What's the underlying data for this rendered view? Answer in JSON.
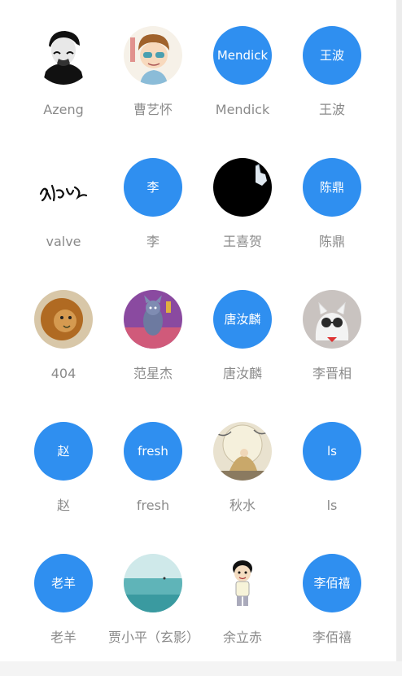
{
  "contacts": [
    {
      "name": "Azeng",
      "avatar_text": "",
      "avatar_icon": "portrait-che-icon"
    },
    {
      "name": "曹艺怀",
      "avatar_text": "",
      "avatar_icon": "cartoon-boy-icon"
    },
    {
      "name": "Mendick",
      "avatar_text": "Mendick",
      "avatar_icon": ""
    },
    {
      "name": "王波",
      "avatar_text": "王波",
      "avatar_icon": ""
    },
    {
      "name": "valve",
      "avatar_text": "",
      "avatar_icon": "calligraphy-icon"
    },
    {
      "name": "李",
      "avatar_text": "李",
      "avatar_icon": ""
    },
    {
      "name": "王喜贺",
      "avatar_text": "",
      "avatar_icon": "black-hand-icon"
    },
    {
      "name": "陈鼎",
      "avatar_text": "陈鼎",
      "avatar_icon": ""
    },
    {
      "name": "404",
      "avatar_text": "",
      "avatar_icon": "lion-icon"
    },
    {
      "name": "范星杰",
      "avatar_text": "",
      "avatar_icon": "cartoon-cat-icon"
    },
    {
      "name": "唐汝麟",
      "avatar_text": "唐汝麟",
      "avatar_icon": ""
    },
    {
      "name": "李晋相",
      "avatar_text": "",
      "avatar_icon": "cat-sunglasses-icon"
    },
    {
      "name": "赵",
      "avatar_text": "赵",
      "avatar_icon": ""
    },
    {
      "name": "fresh",
      "avatar_text": "fresh",
      "avatar_icon": ""
    },
    {
      "name": "秋水",
      "avatar_text": "",
      "avatar_icon": "moon-scholar-icon"
    },
    {
      "name": "ls",
      "avatar_text": "ls",
      "avatar_icon": ""
    },
    {
      "name": "老羊",
      "avatar_text": "老羊",
      "avatar_icon": ""
    },
    {
      "name": "贾小平（玄影）",
      "avatar_text": "",
      "avatar_icon": "sea-icon"
    },
    {
      "name": "余立赤",
      "avatar_text": "",
      "avatar_icon": "cartoon-kid-icon"
    },
    {
      "name": "李佰禧",
      "avatar_text": "李佰禧",
      "avatar_icon": ""
    }
  ],
  "colors": {
    "avatar_blue": "#2f8ff0",
    "name_gray": "#8a8a8a"
  }
}
